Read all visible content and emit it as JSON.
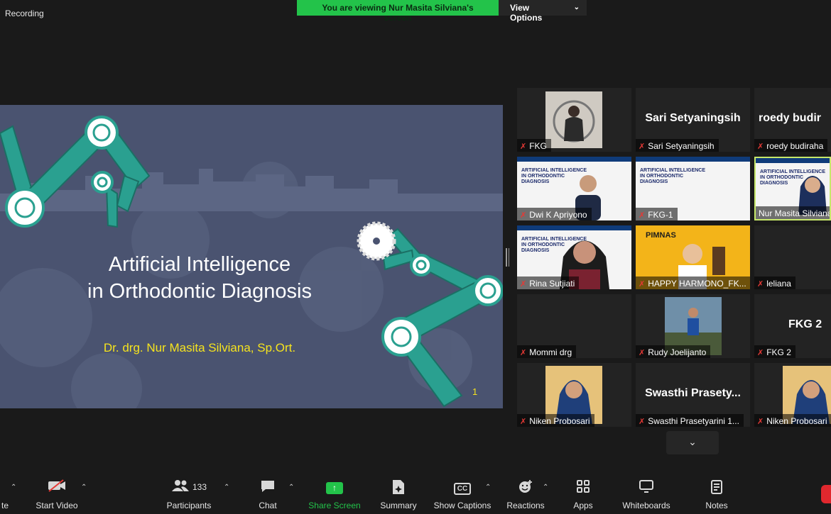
{
  "recording": "Recording",
  "banner": {
    "viewing": "You are viewing Nur Masita Silviana's screen",
    "view_options": "View Options"
  },
  "slide": {
    "title": "Artificial Intelligence\nin Orthodontic Diagnosis",
    "author": "Dr. drg. Nur Masita Silviana, Sp.Ort.",
    "page": "1",
    "colors": {
      "background": "#4a5370",
      "accent": "#2aa090",
      "author": "#f5e31e"
    }
  },
  "gallery": {
    "tiles": [
      {
        "name": "FKG",
        "kind": "photo"
      },
      {
        "name": "Sari Setyaningsih",
        "big": "Sari Setyaningsih",
        "kind": "name"
      },
      {
        "name": "roedy budiraha",
        "big": "roedy  budir",
        "kind": "name"
      },
      {
        "name": "Dwi K Apriyono",
        "kind": "slide",
        "slide_text": "ARTIFICIAL INTELLIGENCE\nIN ORTHODONTIC\nDIAGNOSIS"
      },
      {
        "name": "FKG-1",
        "kind": "slide",
        "slide_text": "ARTIFICIAL INTELLIGENCE\nIN ORTHODONTIC\nDIAGNOSIS"
      },
      {
        "name": "Nur Masita Silviana",
        "kind": "slide",
        "slide_text": "ARTIFICIAL INTELLIGENCE\nIN ORTHODONTIC\nDIAGNOSIS",
        "active": true
      },
      {
        "name": "Rina Sutjiati",
        "kind": "slide",
        "slide_text": "ARTIFICIAL INTELLIGENCE\nIN ORTHODONTIC\nDIAGNOSIS"
      },
      {
        "name": "HAPPY HARMONO_FK...",
        "kind": "poster",
        "poster_text": "PIMNAS"
      },
      {
        "name": "leliana",
        "kind": "blank"
      },
      {
        "name": "Mommi drg",
        "kind": "blank"
      },
      {
        "name": "Rudy Joelijanto",
        "kind": "photo"
      },
      {
        "name": "FKG 2",
        "big": "FKG 2",
        "kind": "name"
      },
      {
        "name": "Niken Probosari",
        "kind": "photo"
      },
      {
        "name": "Swasthi Prasetyarini 1...",
        "big": "Swasthi  Prasety...",
        "kind": "name"
      },
      {
        "name": "Niken Probosari",
        "kind": "photo"
      }
    ]
  },
  "toolbar": {
    "start_video": "Start Video",
    "participants": "Participants",
    "participants_count": "133",
    "chat": "Chat",
    "share_screen": "Share Screen",
    "summary": "Summary",
    "show_captions": "Show Captions",
    "reactions": "Reactions",
    "apps": "Apps",
    "whiteboards": "Whiteboards",
    "notes": "Notes",
    "left_cut": "te",
    "cc": "CC"
  }
}
